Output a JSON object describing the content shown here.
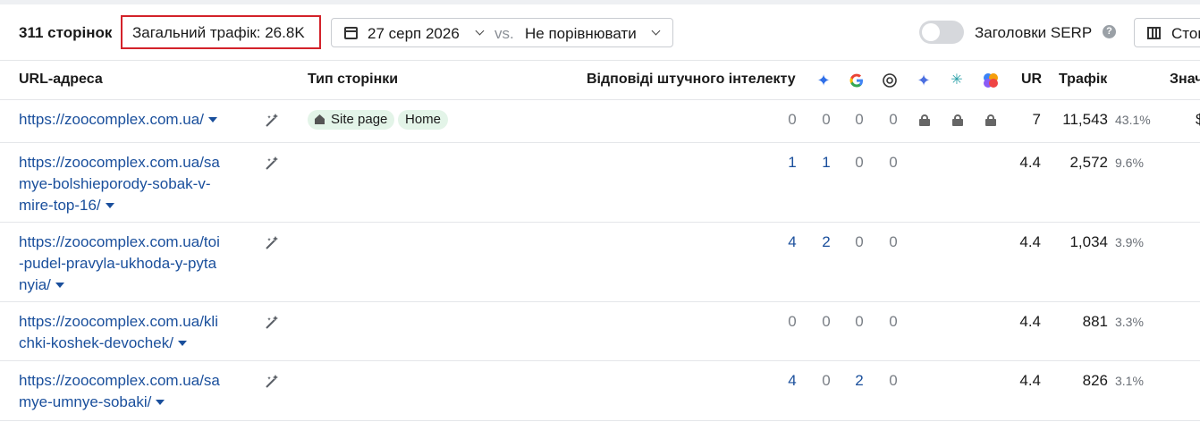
{
  "toolbar": {
    "pages_count": "311 сторінок",
    "total_traffic": "Загальний трафік: 26.8K",
    "date": "27 серп 2026",
    "vs": "vs.",
    "compare": "Не порівнювати",
    "serp_label": "Заголовки SERP",
    "help": "?",
    "columns_label": "Стовпці"
  },
  "columns": {
    "url": "URL-адреса",
    "page_type": "Тип сторінки",
    "ai_answers": "Відповіді штучного інтелекту",
    "ur": "UR",
    "traffic": "Трафік",
    "value": "Значення"
  },
  "icons": {
    "ai_overview": "sparkle-icon",
    "google": "google-icon",
    "chatgpt": "chatgpt-icon",
    "gemini": "gemini-icon",
    "perplexity": "perplexity-icon",
    "copilot": "copilot-icon"
  },
  "colors": {
    "link": "#1a4f9c",
    "highlight_border": "#d3222a",
    "tag_bg": "#e3f4e8"
  },
  "rows": [
    {
      "url_lines": [
        "https://zoocomplex.com.ua/"
      ],
      "tags": [
        "Site page",
        "Home"
      ],
      "ai": [
        "0",
        "0",
        "0",
        "0"
      ],
      "locked": true,
      "ur": "7",
      "traffic": "11,543",
      "share": "43.1%",
      "value": "$"
    },
    {
      "url_lines": [
        "https://zoocomplex.com.ua/sa",
        "mye-bolshieporody-sobak-v-",
        "mire-top-16/"
      ],
      "tags": [],
      "ai": [
        "1",
        "1",
        "0",
        "0"
      ],
      "locked": false,
      "ur": "4.4",
      "traffic": "2,572",
      "share": "9.6%"
    },
    {
      "url_lines": [
        "https://zoocomplex.com.ua/toi",
        "-pudel-pravyla-ukhoda-y-pyta",
        "nyia/"
      ],
      "tags": [],
      "ai": [
        "4",
        "2",
        "0",
        "0"
      ],
      "locked": false,
      "ur": "4.4",
      "traffic": "1,034",
      "share": "3.9%"
    },
    {
      "url_lines": [
        "https://zoocomplex.com.ua/kli",
        "chki-koshek-devochek/"
      ],
      "tags": [],
      "ai": [
        "0",
        "0",
        "0",
        "0"
      ],
      "locked": false,
      "ur": "4.4",
      "traffic": "881",
      "share": "3.3%"
    },
    {
      "url_lines": [
        "https://zoocomplex.com.ua/sa",
        "mye-umnye-sobaki/"
      ],
      "tags": [],
      "ai": [
        "4",
        "0",
        "2",
        "0"
      ],
      "locked": false,
      "ur": "4.4",
      "traffic": "826",
      "share": "3.1%"
    }
  ]
}
